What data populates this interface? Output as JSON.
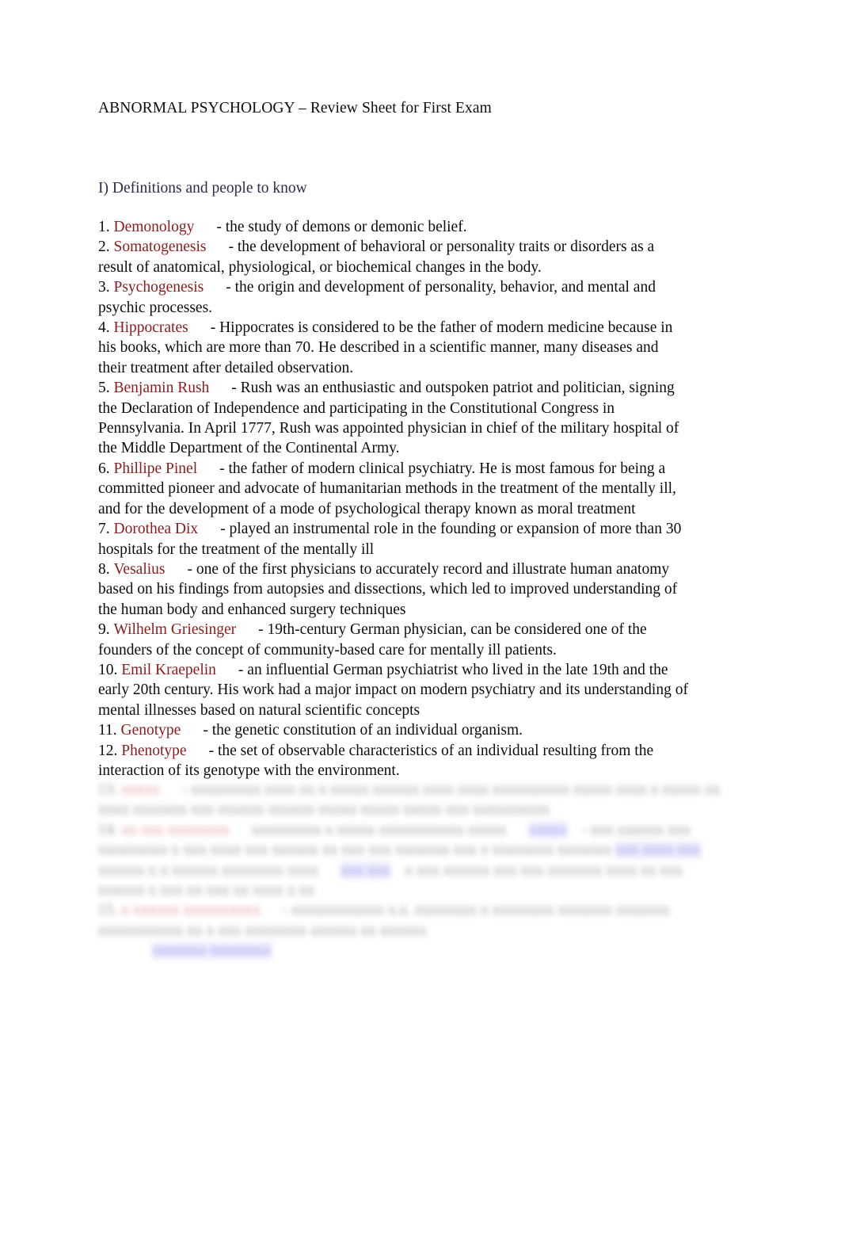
{
  "document": {
    "title": "ABNORMAL PSYCHOLOGY – Review Sheet for First Exam",
    "section_heading": "I) Definitions and people to know",
    "colors": {
      "term_color": "#8d1b1b",
      "heading_color": "#2b2b4e",
      "body_color": "#0d0d0d",
      "link_color": "#3b3bd6",
      "page_background": "#ffffff"
    },
    "entries": [
      {
        "number": "1.",
        "term": "Demonology",
        "definition": "- the study of demons or demonic belief."
      },
      {
        "number": "2.",
        "term": "Somatogenesis",
        "definition": "- the development of behavioral or personality traits or disorders as a result of anatomical, physiological, or biochemical changes in the body."
      },
      {
        "number": "3.",
        "term": "Psychogenesis",
        "definition": "- the origin and development of personality, behavior, and mental and psychic processes."
      },
      {
        "number": "4.",
        "term": "Hippocrates",
        "definition": "- Hippocrates is considered to be the father of modern medicine because in his books, which are more than 70. He described in a scientific manner, many diseases and their treatment after detailed observation."
      },
      {
        "number": "5.",
        "term": "Benjamin Rush",
        "definition": "- Rush was an enthusiastic and outspoken patriot and politician, signing the Declaration of Independence and participating in the Constitutional Congress in Pennsylvania. In April 1777, Rush was appointed physician in chief of the military hospital of the Middle Department of the Continental Army."
      },
      {
        "number": "6.",
        "term": "Phillipe Pinel",
        "definition": "- the father of modern clinical psychiatry. He is most famous for being a committed pioneer and advocate of humanitarian methods in the treatment of the mentally ill, and for the development of a mode of psychological therapy known as moral treatment"
      },
      {
        "number": "7.",
        "term": "Dorothea Dix",
        "definition": "- played an instrumental role in the founding or expansion of more than 30 hospitals for the treatment of the mentally ill"
      },
      {
        "number": "8.",
        "term": "Vesalius",
        "definition": "- one of the first physicians to accurately record and illustrate human anatomy based on his findings from autopsies and dissections, which led to improved understanding of the human body and enhanced surgery techniques"
      },
      {
        "number": "9.",
        "term": "Wilhelm Griesinger",
        "definition": "- 19th-century German physician, can be considered one of the founders of the concept of community-based care for mentally ill patients."
      },
      {
        "number": "10.",
        "term": "Emil Kraepelin",
        "definition": "- an influential German psychiatrist who lived in the late 19th and the early 20th century. His work had a major impact on modern psychiatry and its understanding of mental illnesses based on natural scientific concepts"
      },
      {
        "number": "11.",
        "term": "Genotype",
        "definition": "- the genetic constitution of an individual organism."
      },
      {
        "number": "12.",
        "term": "Phenotype",
        "definition": "- the set of observable characteristics of an individual resulting from the interaction of its genotype with the environment."
      }
    ],
    "obscured_tail": {
      "note": "illegible blurred continuation of the numbered list",
      "lines": [
        {
          "number": "13.",
          "term": "xxxxx",
          "text": "- xxxxxxxxx xxxx xx x xxxxx xxxxxx xxxx xxxx xxxxxxxxxx"
        },
        {
          "text": "xxxxx xxxx x xxxxx xx xxxx xxxxxxx xxx xxxxxx xxxxxx xxxxx xxxxx"
        },
        {
          "text": "xxxxx xxx xxxxxxxxxx"
        },
        {
          "number": "14.",
          "term": "xx xxx xxxxxxxx",
          "text": "xxxxxxxxx x xxxxx xxxxxxxxxxx xxxxx",
          "link": "xxxxx",
          "tail": "- xxx xxxxxx xxx"
        },
        {
          "text": "xxxxxxxxx x xxx xxxx xxx xxxxxx xx xxx xxx xxxxxxx xxx x xxxxxxxx xxxxxxx"
        },
        {
          "link": "xxx xxxx xxx",
          "text": "xxxxxx x x xxxxxx xxxxxxxx xxxx",
          "link2": "xxx xxx",
          "tail": "x xxx xxxxxx xxx xxx xxxxxxx"
        },
        {
          "text": "xxxx xx xxx xxxxxx x xxx xx xxx xx xxxx x xx"
        },
        {
          "number": "15.",
          "term": "x xxxxxx xxxxxxxxxx",
          "text": "- xxxxxxxxxxxx x.x. xxxxxxxx x xxxxxxxx xxxxxxx xxxxxxx"
        },
        {
          "text": "xxxxxxxxxxx xx x xxx xxxxxxxx xxxxxx xx xxxxxx"
        },
        {
          "link": "xxxxxxx xxxxxxxx"
        }
      ]
    }
  }
}
